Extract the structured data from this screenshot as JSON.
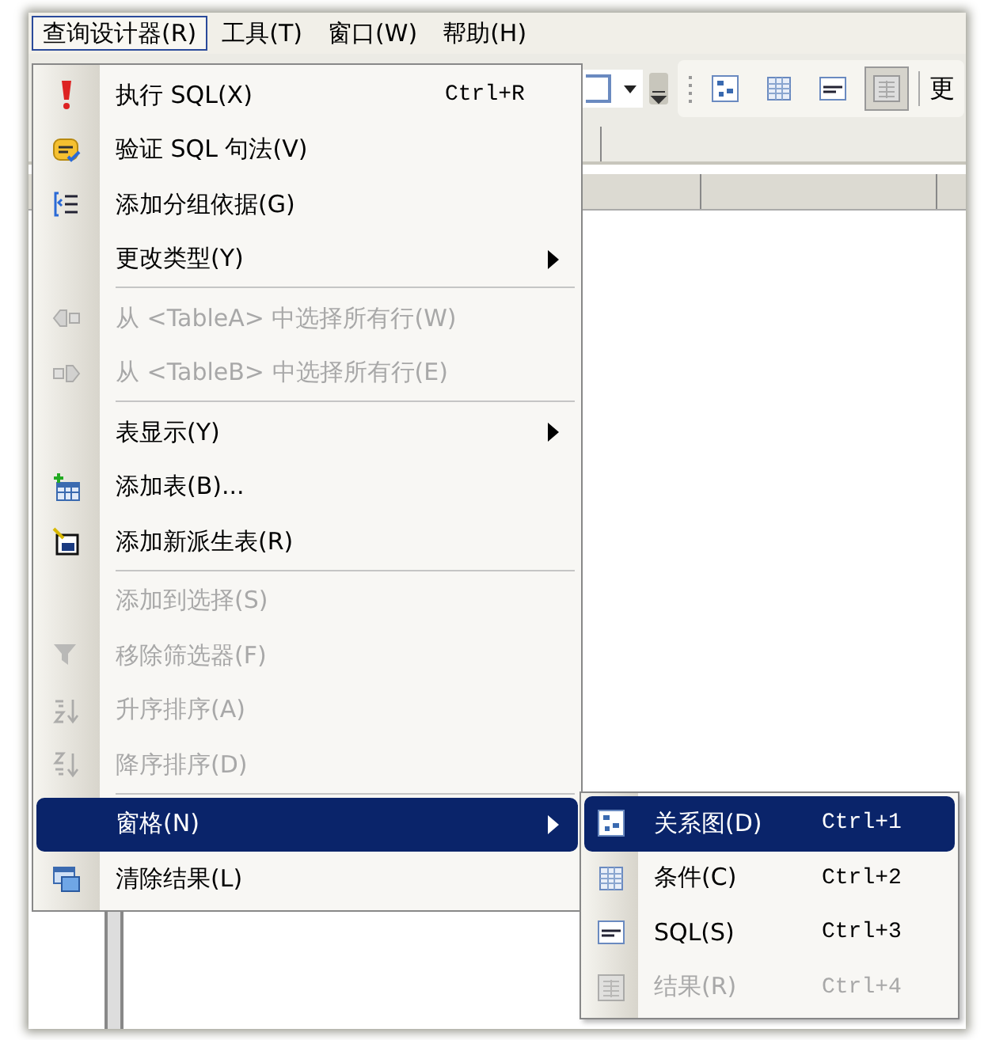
{
  "menu_bar": [
    {
      "label": "查询设计器(R)",
      "selected": true
    },
    {
      "label": "工具(T)",
      "selected": false
    },
    {
      "label": "窗口(W)",
      "selected": false
    },
    {
      "label": "帮助(H)",
      "selected": false
    }
  ],
  "toolbar": {
    "cut_text": "更"
  },
  "menu": {
    "items": [
      {
        "kind": "item",
        "label": "执行 SQL(X)",
        "shortcut": "Ctrl+R",
        "disabled": false,
        "selected": false
      },
      {
        "kind": "item",
        "label": "验证 SQL 句法(V)",
        "disabled": false,
        "selected": false
      },
      {
        "kind": "item",
        "label": "添加分组依据(G)",
        "disabled": false,
        "selected": false
      },
      {
        "kind": "submenu",
        "label": "更改类型(Y)",
        "disabled": false,
        "selected": false
      },
      {
        "kind": "separator"
      },
      {
        "kind": "item",
        "label": "从 <TableA> 中选择所有行(W)",
        "disabled": true,
        "selected": false
      },
      {
        "kind": "item",
        "label": "从 <TableB> 中选择所有行(E)",
        "disabled": true,
        "selected": false
      },
      {
        "kind": "separator"
      },
      {
        "kind": "submenu",
        "label": "表显示(Y)",
        "disabled": false,
        "selected": false
      },
      {
        "kind": "item",
        "label": "添加表(B)...",
        "disabled": false,
        "selected": false
      },
      {
        "kind": "item",
        "label": "添加新派生表(R)",
        "disabled": false,
        "selected": false
      },
      {
        "kind": "separator"
      },
      {
        "kind": "item",
        "label": "添加到选择(S)",
        "disabled": true,
        "selected": false
      },
      {
        "kind": "item",
        "label": "移除筛选器(F)",
        "disabled": true,
        "selected": false
      },
      {
        "kind": "item",
        "label": "升序排序(A)",
        "disabled": true,
        "selected": false
      },
      {
        "kind": "item",
        "label": "降序排序(D)",
        "disabled": true,
        "selected": false
      },
      {
        "kind": "separator"
      },
      {
        "kind": "submenu",
        "label": "窗格(N)",
        "disabled": false,
        "selected": true
      },
      {
        "kind": "item",
        "label": "清除结果(L)",
        "disabled": false,
        "selected": false
      }
    ]
  },
  "submenu": {
    "items": [
      {
        "label": "关系图(D)",
        "shortcut": "Ctrl+1",
        "disabled": false,
        "selected": true
      },
      {
        "label": "条件(C)",
        "shortcut": "Ctrl+2",
        "disabled": false,
        "selected": false
      },
      {
        "label": "SQL(S)",
        "shortcut": "Ctrl+3",
        "disabled": false,
        "selected": false
      },
      {
        "label": "结果(R)",
        "shortcut": "Ctrl+4",
        "disabled": true,
        "selected": false
      }
    ]
  }
}
